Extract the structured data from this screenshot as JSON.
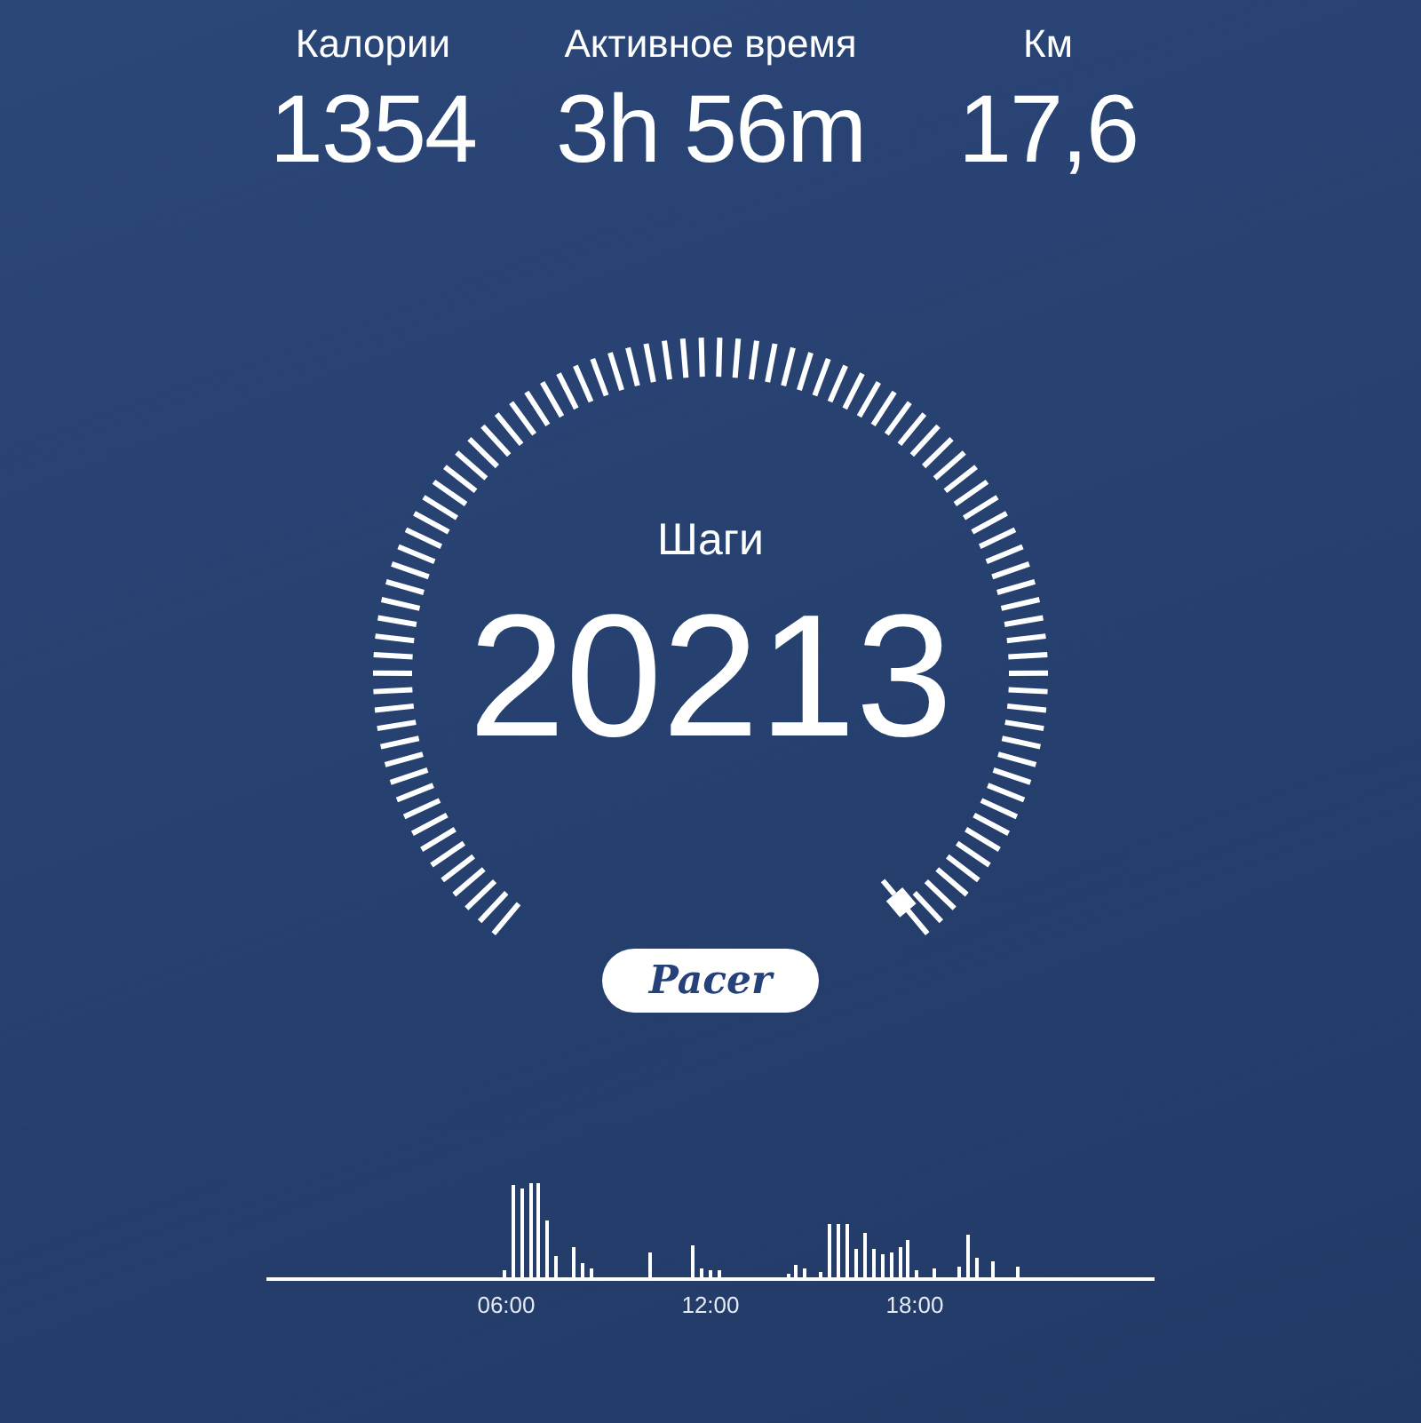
{
  "stats": [
    {
      "label": "Калории",
      "value": "1354"
    },
    {
      "label": "Активное время",
      "value": "3h 56m"
    },
    {
      "label": "Км",
      "value": "17,6"
    }
  ],
  "steps": {
    "label": "Шаги",
    "value": "20213"
  },
  "logo": "Pacer",
  "activity_chart": {
    "xlabels": [
      "06:00",
      "12:00",
      "18:00"
    ]
  }
}
